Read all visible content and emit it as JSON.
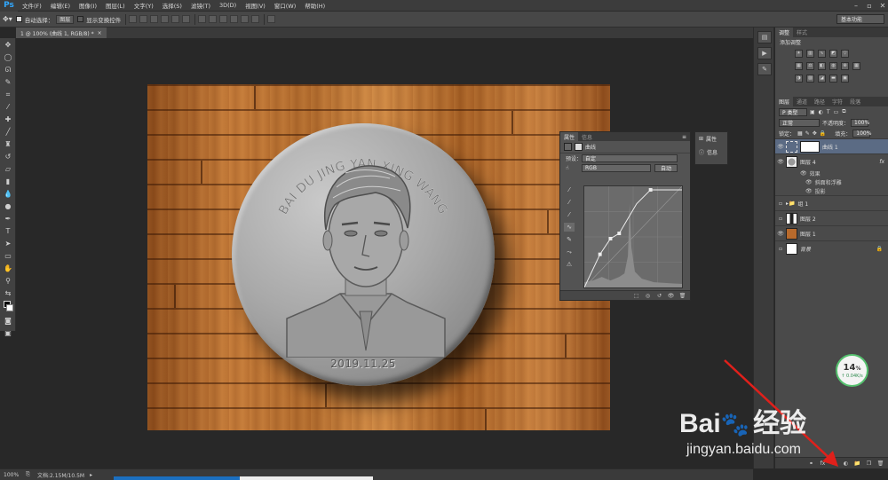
{
  "app": {
    "logo": "Ps",
    "menu": [
      "文件(F)",
      "编辑(E)",
      "图像(I)",
      "图层(L)",
      "文字(Y)",
      "选择(S)",
      "滤镜(T)",
      "3D(D)",
      "视图(V)",
      "窗口(W)",
      "帮助(H)"
    ],
    "window_controls": [
      "–",
      "▫",
      "✕"
    ]
  },
  "options": {
    "auto_select_label": "自动选择：",
    "auto_select_value": "图层",
    "show_transform_label": "显示变换控件",
    "workspace": "基本功能"
  },
  "document": {
    "tab_title": "1 @ 100% (曲线 1, RGB/8) *",
    "tab_close": "×"
  },
  "coin": {
    "arc_text": "BAI DU JING YAN XING WANG",
    "date": "2019.11.25"
  },
  "curves_panel": {
    "tab_properties": "属性",
    "tab_info": "信息",
    "header_title": "曲线",
    "preset_label": "预设：",
    "preset_value": "自定",
    "channel_value": "RGB",
    "auto_label": "自动"
  },
  "mini_panel": {
    "properties": "属性",
    "info": "信息"
  },
  "adjustments": {
    "tabs": [
      "调整",
      "样式"
    ],
    "title": "添加调整"
  },
  "layers": {
    "tabs": [
      "图层",
      "通道",
      "路径",
      "字符",
      "段落"
    ],
    "kind_label": "P 类型",
    "blend_mode": "正常",
    "opacity_label": "不透明度：",
    "opacity_value": "100%",
    "lock_label": "锁定：",
    "fill_label": "填充：",
    "fill_value": "100%",
    "items": [
      {
        "name": "曲线 1",
        "selected": true
      },
      {
        "name": "图层 4",
        "fx": "fx"
      },
      {
        "name": "效果",
        "effect": true
      },
      {
        "name": "斜面和浮雕",
        "effect": true
      },
      {
        "name": "投影",
        "effect": true
      },
      {
        "name": "组 1"
      },
      {
        "name": "图层 2"
      },
      {
        "name": "图层 1"
      },
      {
        "name": "背景",
        "locked": true
      }
    ]
  },
  "status": {
    "zoom": "100%",
    "doc_info": "文档:2.15M/10.5M"
  },
  "network": {
    "percent": "14",
    "unit": "%",
    "speed": "↑ 0.04K/s"
  },
  "watermark": {
    "brand": "Bai",
    "brand_cn": "经验",
    "url": "jingyan.baidu.com"
  },
  "colors": {
    "accent": "#31a8ff",
    "selected_layer": "#5b6b84",
    "arrow": "#e0201b",
    "net_ring": "#55c06e"
  }
}
